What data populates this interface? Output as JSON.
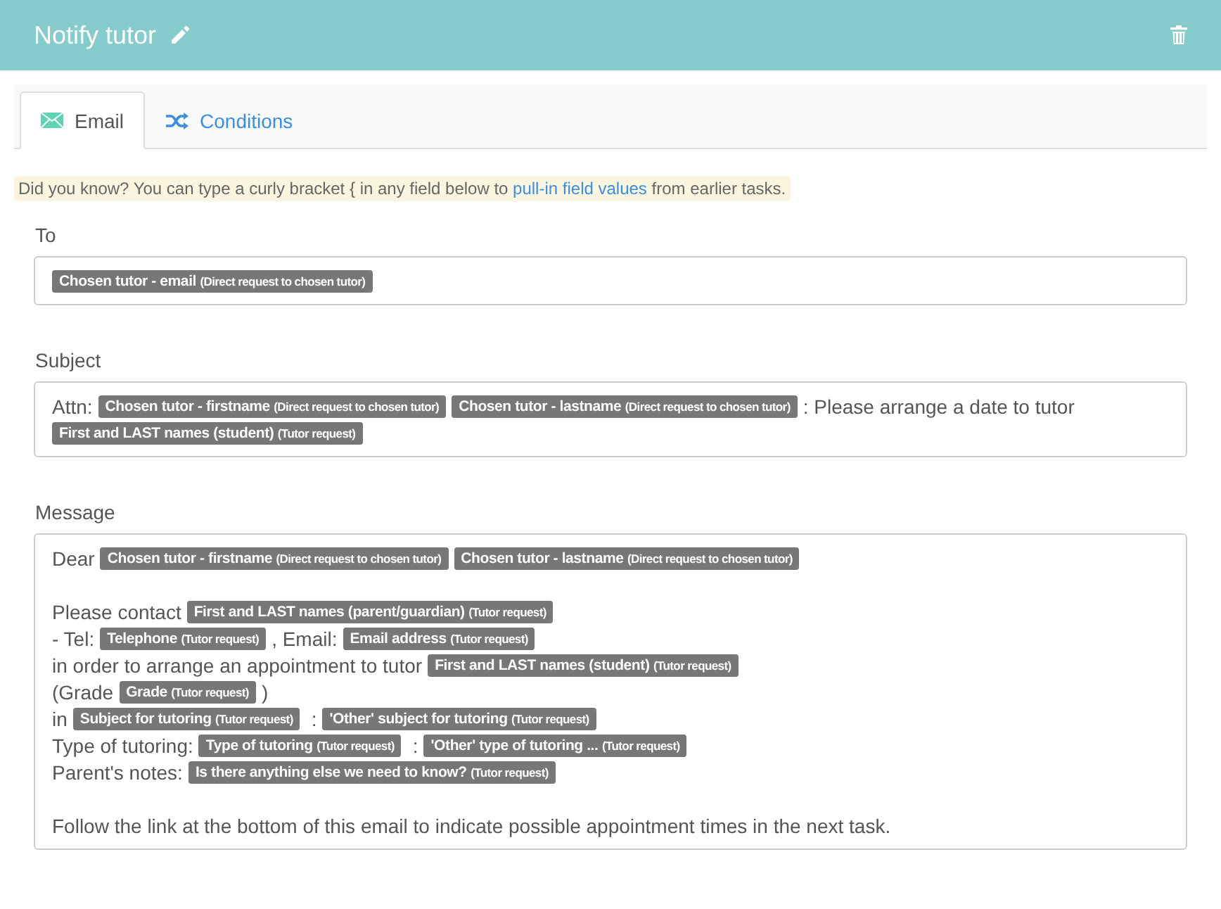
{
  "header": {
    "title": "Notify tutor"
  },
  "tabs": [
    {
      "label": "Email",
      "selected": true
    },
    {
      "label": "Conditions",
      "selected": false
    }
  ],
  "hint": {
    "before": "Did you know? You can type a curly bracket { in any field below to ",
    "link": "pull-in field values",
    "after": " from earlier tasks."
  },
  "fields": [
    {
      "label": "To",
      "lines": [
        {
          "kind": "text",
          "segments": [
            {
              "kind": "token",
              "text": "Chosen tutor - email",
              "source": "(Direct request to chosen tutor)"
            }
          ]
        }
      ]
    },
    {
      "label": "Subject",
      "lines": [
        {
          "kind": "text",
          "segments": [
            {
              "kind": "text",
              "text": "Attn:"
            },
            {
              "kind": "token",
              "text": "Chosen tutor - firstname",
              "source": "(Direct request to chosen tutor)"
            },
            {
              "kind": "token",
              "text": "Chosen tutor - lastname",
              "source": "(Direct request to chosen tutor)"
            },
            {
              "kind": "attached",
              "text": ": Please arrange a date to tutor"
            }
          ]
        },
        {
          "kind": "text",
          "segments": [
            {
              "kind": "token",
              "text": "First and LAST names (student)",
              "source": "(Tutor request)"
            }
          ]
        }
      ]
    },
    {
      "label": "Message",
      "lines": [
        {
          "kind": "text",
          "segments": [
            {
              "kind": "text",
              "text": "Dear"
            },
            {
              "kind": "token",
              "text": "Chosen tutor - firstname",
              "source": "(Direct request to chosen tutor)"
            },
            {
              "kind": "token",
              "text": "Chosen tutor - lastname",
              "source": "(Direct request to chosen tutor)"
            }
          ]
        },
        {
          "kind": "blank"
        },
        {
          "kind": "text",
          "segments": [
            {
              "kind": "text",
              "text": "Please contact"
            },
            {
              "kind": "token",
              "text": "First and LAST names (parent/guardian)",
              "source": "(Tutor request)"
            }
          ]
        },
        {
          "kind": "text",
          "segments": [
            {
              "kind": "text",
              "text": "- Tel:"
            },
            {
              "kind": "token",
              "text": "Telephone",
              "source": "(Tutor request)"
            },
            {
              "kind": "attached",
              "text": ", Email:"
            },
            {
              "kind": "token",
              "text": "Email address",
              "source": "(Tutor request)"
            }
          ]
        },
        {
          "kind": "text",
          "segments": [
            {
              "kind": "text",
              "text": "in order to arrange an appointment to tutor"
            },
            {
              "kind": "token",
              "text": "First and LAST names (student)",
              "source": "(Tutor request)"
            }
          ]
        },
        {
          "kind": "text",
          "segments": [
            {
              "kind": "text",
              "text": "(Grade"
            },
            {
              "kind": "token",
              "text": "Grade",
              "source": "(Tutor request)"
            },
            {
              "kind": "attached",
              "text": ")"
            }
          ]
        },
        {
          "kind": "text",
          "segments": [
            {
              "kind": "text",
              "text": "in"
            },
            {
              "kind": "token",
              "text": "Subject for tutoring",
              "source": "(Tutor request)"
            },
            {
              "kind": "text",
              "text": ":"
            },
            {
              "kind": "token",
              "text": "'Other' subject for tutoring",
              "source": "(Tutor request)"
            }
          ]
        },
        {
          "kind": "text",
          "segments": [
            {
              "kind": "text",
              "text": "Type of tutoring:"
            },
            {
              "kind": "token",
              "text": "Type of tutoring",
              "source": "(Tutor request)"
            },
            {
              "kind": "text",
              "text": ":"
            },
            {
              "kind": "token",
              "text": "'Other' type of tutoring ...",
              "source": "(Tutor request)"
            }
          ]
        },
        {
          "kind": "text",
          "segments": [
            {
              "kind": "text",
              "text": "Parent's notes:"
            },
            {
              "kind": "token",
              "text": "Is there anything else we need to know?",
              "source": "(Tutor request)"
            }
          ]
        },
        {
          "kind": "blank"
        },
        {
          "kind": "text",
          "segments": [
            {
              "kind": "text",
              "text": "Follow the link at the bottom of this email to indicate possible appointment times in the next task."
            }
          ]
        }
      ]
    }
  ]
}
